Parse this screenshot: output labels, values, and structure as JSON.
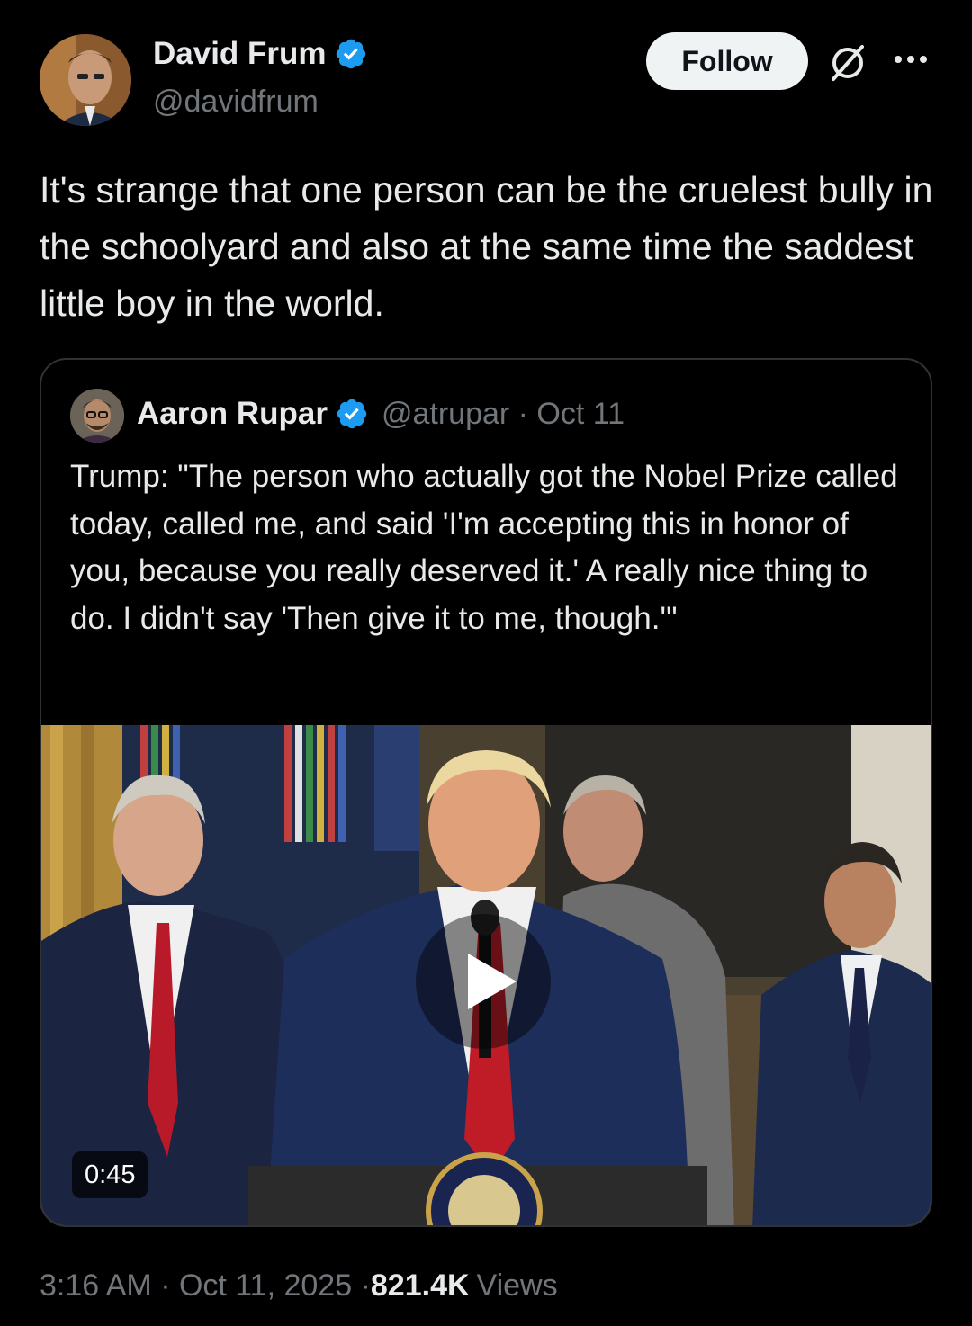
{
  "tweet": {
    "author": {
      "name": "David Frum",
      "handle": "@davidfrum",
      "verified": true
    },
    "follow_label": "Follow",
    "icons": {
      "verified": "verified-badge-icon",
      "grok": "grok-icon",
      "more": "more-options-icon"
    },
    "text": "It's strange that one person can be the cruelest bully in the schoolyard and also at the same time the saddest little boy in the world.",
    "timestamp": "3:16 AM · Oct 11, 2025 · ",
    "views_count": "821.4K",
    "views_label": "Views"
  },
  "quoted": {
    "author": {
      "name": "Aaron Rupar",
      "handle": "@atrupar",
      "verified": true
    },
    "meta": "@atrupar · Oct 11",
    "text": "Trump: \"The person who actually got the Nobel Prize called today, called me, and said 'I'm accepting this in honor of you, because you really deserved it.' A really nice thing to do. I didn't say 'Then give it to me, though.'\"",
    "video": {
      "duration": "0:45",
      "play_icon": "play-icon"
    }
  },
  "colors": {
    "background": "#000000",
    "text": "#e7e9ea",
    "secondary": "#71767b",
    "verified": "#1d9bf0",
    "border": "#2f3336"
  }
}
